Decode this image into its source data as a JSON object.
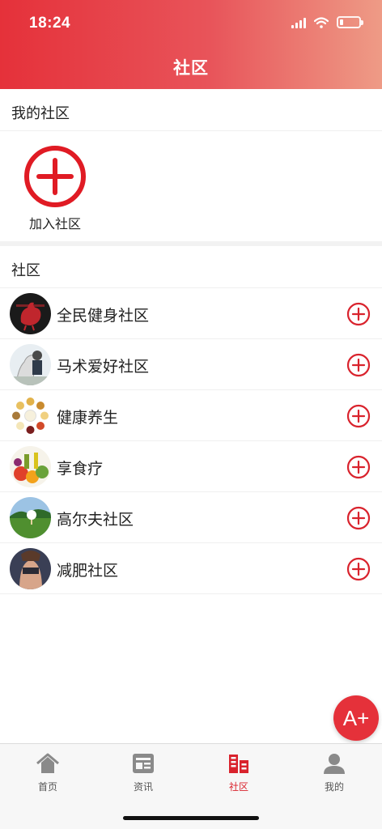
{
  "status_bar": {
    "time": "18:24",
    "battery_level": 0.2,
    "icons": [
      "signal-icon",
      "wifi-icon",
      "battery-icon"
    ]
  },
  "header": {
    "title": "社区"
  },
  "my_communities": {
    "title": "我的社区",
    "join_label": "加入社区",
    "join_icon": "plus-circle-icon"
  },
  "communities": {
    "title": "社区",
    "items": [
      {
        "label": "全民健身社区",
        "avatar_icon": "rooster-avatar",
        "action_icon": "plus-circle-icon"
      },
      {
        "label": "马术爱好社区",
        "avatar_icon": "horse-avatar",
        "action_icon": "plus-circle-icon"
      },
      {
        "label": "健康养生",
        "avatar_icon": "grains-avatar",
        "action_icon": "plus-circle-icon"
      },
      {
        "label": "享食疗",
        "avatar_icon": "vegetables-avatar",
        "action_icon": "plus-circle-icon"
      },
      {
        "label": "高尔夫社区",
        "avatar_icon": "golf-avatar",
        "action_icon": "plus-circle-icon"
      },
      {
        "label": "减肥社区",
        "avatar_icon": "fitness-avatar",
        "action_icon": "plus-circle-icon"
      }
    ]
  },
  "font_button": {
    "label": "A+"
  },
  "tabbar": {
    "tabs": [
      {
        "label": "首页",
        "icon": "home-icon",
        "active": false
      },
      {
        "label": "资讯",
        "icon": "news-icon",
        "active": false
      },
      {
        "label": "社区",
        "icon": "community-icon",
        "active": true
      },
      {
        "label": "我的",
        "icon": "profile-icon",
        "active": false
      }
    ]
  },
  "colors": {
    "accent": "#e5313a",
    "header_gradient_end": "#ee9b86",
    "active_tab": "#d9232d",
    "inactive_tab": "#8a8a8a"
  }
}
